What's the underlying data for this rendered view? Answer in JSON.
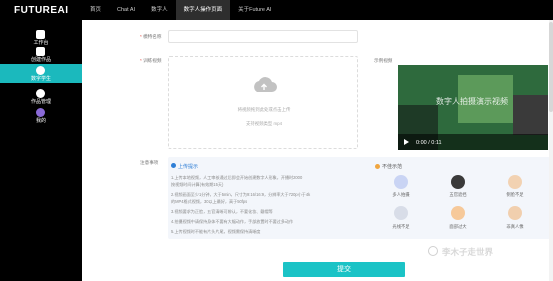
{
  "app": {
    "logo": "FUTUREAI"
  },
  "topnav": [
    {
      "label": "首页"
    },
    {
      "label": "Chat AI"
    },
    {
      "label": "数字人"
    },
    {
      "label": "数字人操作页面"
    },
    {
      "label": "关于Future AI"
    }
  ],
  "sidebar": [
    {
      "label": "工作台",
      "icon": "home-icon"
    },
    {
      "label": "创建作品",
      "icon": "create-icon"
    },
    {
      "label": "数字学生",
      "icon": "digital-student-icon"
    },
    {
      "label": "作品管理",
      "icon": "manage-icon"
    },
    {
      "label": "我的",
      "icon": "profile-icon"
    }
  ],
  "form": {
    "name_label": "模特名称",
    "name_value": "",
    "video_label": "训练视频",
    "example_label": "示例视频",
    "upload_hint_1": "将视频拖到此处或点击上传",
    "upload_hint_2": "支持视频类型 mp4",
    "example_video_title": "数字人拍摄演示视频",
    "example_video_time": "0:00 / 0:11"
  },
  "notes": {
    "label": "注意事项",
    "tips_title": "上传提示",
    "tips": [
      "1.上传本地视频，人工审核通过后即会开始创建数字人形象，开播时2000",
      "  按视频时间计算(有效期15天)",
      "2.视频画面至少1分钟，大于5min，尺寸为9:16/16:9，分辨率大于720p小于4k",
      "  的MP4格式视频，30以上最好，高于50fps",
      "3.视频要求为正脸，五官清晰可辨认，不要化妆、戴帽等",
      "4.拍摄视频中请保持身体不要有大幅动作，手部放置时不要过多动作",
      "5.上传视频时不能有片头片尾，视频需保持清晰度"
    ],
    "bad_title": "不佳示范",
    "bad_examples": [
      {
        "label": "多人拍摄"
      },
      {
        "label": "五官遮挡"
      },
      {
        "label": "侧脸不足"
      },
      {
        "label": "光线不足"
      },
      {
        "label": "面部过大"
      },
      {
        "label": "非真人像"
      }
    ]
  },
  "submit_label": "提交",
  "watermark": "李木子走世界",
  "colors": {
    "accent": "#1bc3c6",
    "sidebar_bg": "#000000",
    "link": "#2f7fd6"
  }
}
